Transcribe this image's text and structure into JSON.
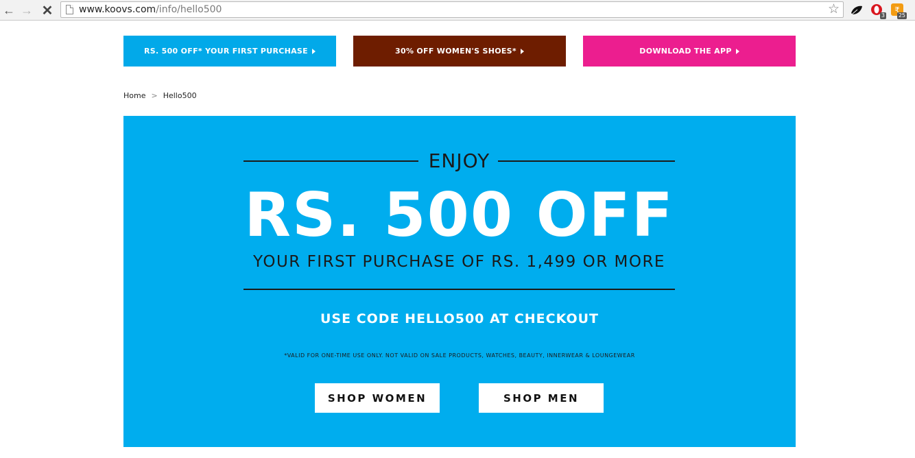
{
  "browser": {
    "url_host": "www.koovs.com",
    "url_path": "/info/hello500",
    "icons": {
      "back": "back-arrow-icon",
      "forward": "forward-arrow-icon",
      "stop": "stop-icon",
      "page": "page-icon",
      "bookmark": "star-icon"
    },
    "extensions": [
      {
        "name": "leaf-extension-icon",
        "badge": ""
      },
      {
        "name": "opera-extension-icon",
        "badge": "3"
      },
      {
        "name": "orange-extension-icon",
        "badge": "25"
      }
    ]
  },
  "promo_strip": [
    {
      "label": "RS. 500 OFF* YOUR FIRST PURCHASE",
      "color": "#02a9e9"
    },
    {
      "label": "30% OFF WOMEN'S SHOES*",
      "color": "#6e1d00"
    },
    {
      "label": "DOWNLOAD THE APP",
      "color": "#ec1e8f"
    }
  ],
  "breadcrumb": {
    "home": "Home",
    "separator": ">",
    "current": "Hello500"
  },
  "hero": {
    "background": "#00adee",
    "eyebrow": "ENJOY",
    "headline": "RS. 500 OFF",
    "subline": "YOUR FIRST PURCHASE OF RS. 1,499 OR MORE",
    "code_line": "USE CODE HELLO500 AT CHECKOUT",
    "fine_print": "*VALID FOR ONE-TIME USE ONLY. NOT VALID ON SALE PRODUCTS, WATCHES, BEAUTY, INNERWEAR & LOUNGEWEAR",
    "buttons": {
      "women": "SHOP WOMEN",
      "men": "SHOP MEN"
    }
  }
}
